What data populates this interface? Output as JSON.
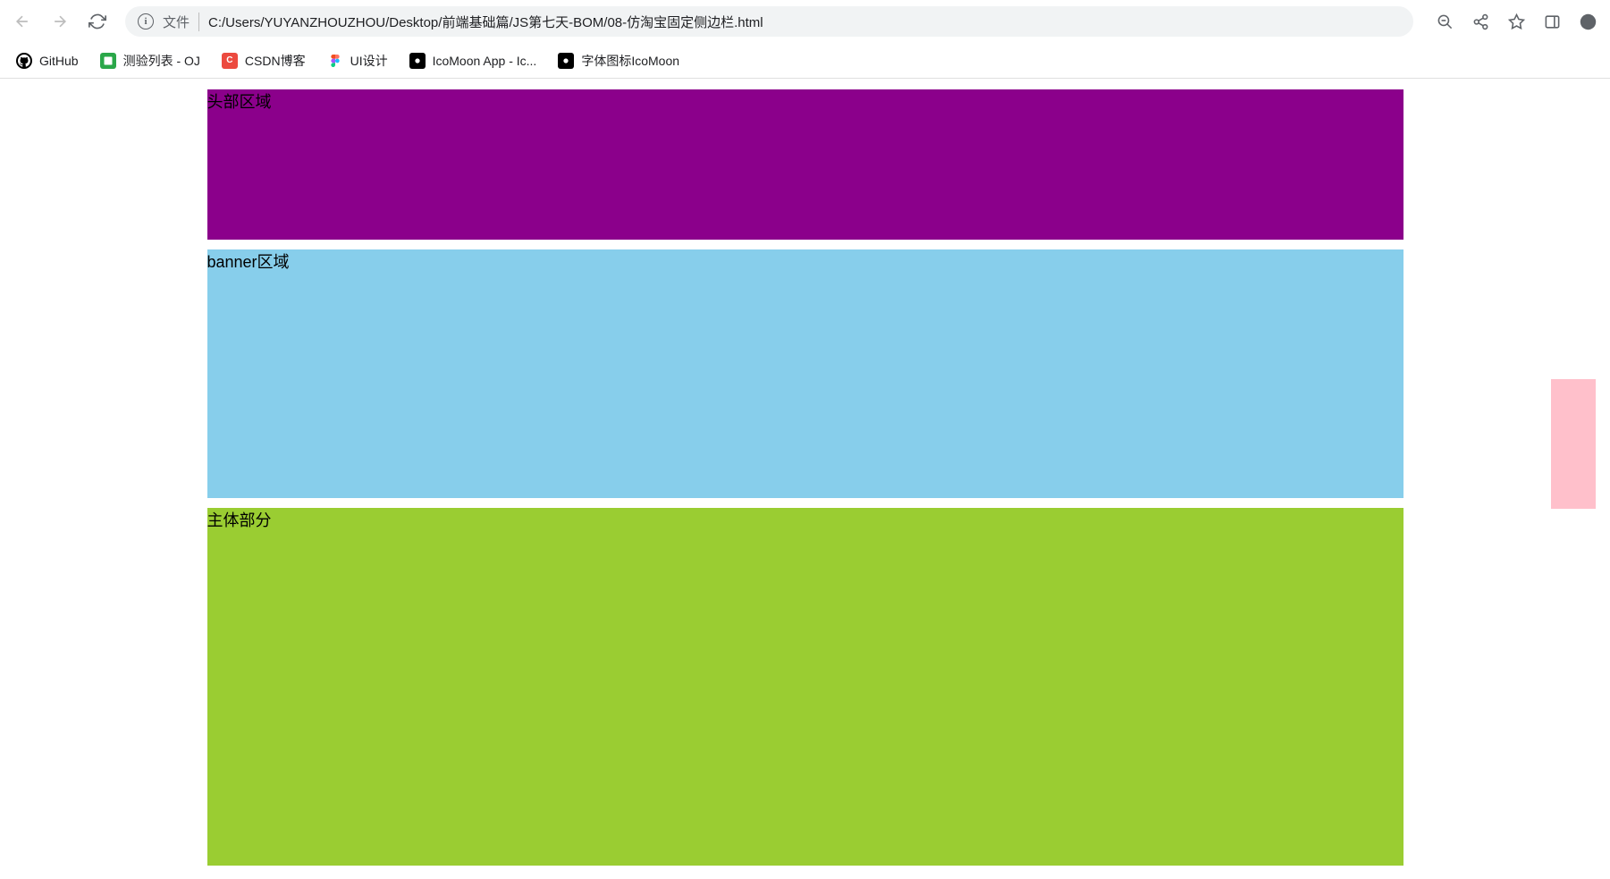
{
  "browser": {
    "file_label": "文件",
    "url": "C:/Users/YUYANZHOUZHOU/Desktop/前端基础篇/JS第七天-BOM/08-仿淘宝固定侧边栏.html"
  },
  "bookmarks": [
    {
      "label": "GitHub",
      "favicon": "github"
    },
    {
      "label": "测验列表 - OJ",
      "favicon": "oj"
    },
    {
      "label": "CSDN博客",
      "favicon": "csdn"
    },
    {
      "label": "UI设计",
      "favicon": "figma"
    },
    {
      "label": "IcoMoon App - Ic...",
      "favicon": "icomoon"
    },
    {
      "label": "字体图标IcoMoon",
      "favicon": "icomoon"
    }
  ],
  "page": {
    "header_text": "头部区域",
    "banner_text": "banner区域",
    "main_text": "主体部分"
  }
}
